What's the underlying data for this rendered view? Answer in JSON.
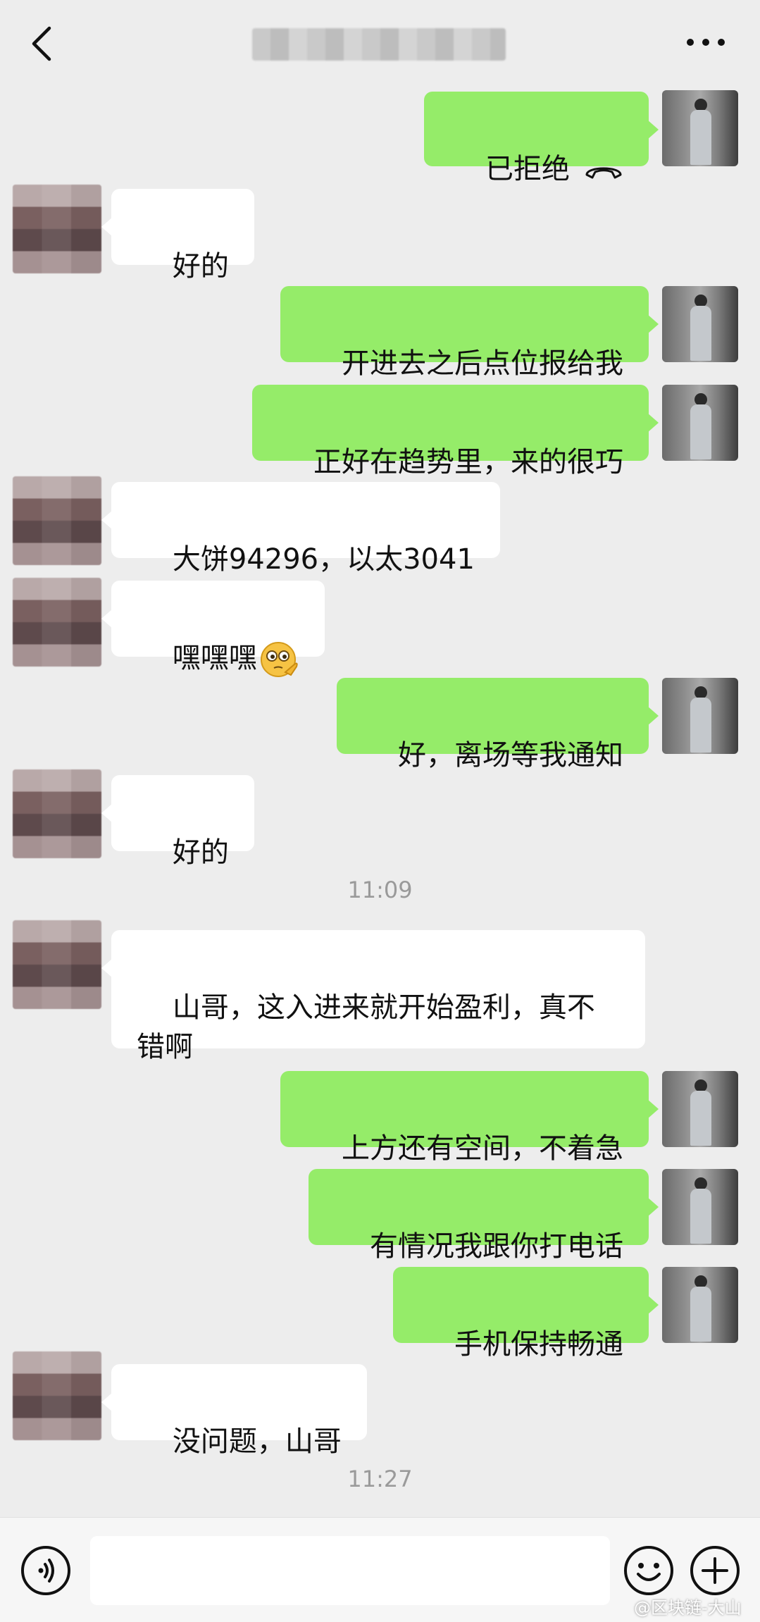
{
  "header": {
    "title": "",
    "back_icon": "chevron-left-icon",
    "more_icon": "more-dots-icon"
  },
  "messages": [
    {
      "from": "me",
      "text": "已拒绝",
      "icon": "phone-hangup-icon"
    },
    {
      "from": "other",
      "text": "好的"
    },
    {
      "from": "me",
      "text": "开进去之后点位报给我"
    },
    {
      "from": "me",
      "text": "正好在趋势里，来的很巧"
    },
    {
      "from": "other",
      "text": "大饼94296，以太3041"
    },
    {
      "from": "other",
      "text": "嘿嘿嘿",
      "icon": "thinking-emoji-icon"
    },
    {
      "from": "me",
      "text": "好，离场等我通知"
    },
    {
      "from": "other",
      "text": "好的"
    },
    {
      "from": "other",
      "text": "山哥，这入进来就开始盈利，真不\n错啊"
    },
    {
      "from": "me",
      "text": "上方还有空间，不着急"
    },
    {
      "from": "me",
      "text": "有情况我跟你打电话"
    },
    {
      "from": "me",
      "text": "手机保持畅通"
    },
    {
      "from": "other",
      "text": "没问题，山哥"
    }
  ],
  "timestamps": [
    "11:09",
    "11:27"
  ],
  "bottom_bar": {
    "input_value": "",
    "input_placeholder": "",
    "voice_icon": "voice-icon",
    "emoji_icon": "emoji-icon",
    "plus_icon": "plus-icon"
  },
  "watermark": "@区块链-大山",
  "colors": {
    "background": "#ededed",
    "my_bubble": "#95ec69",
    "other_bubble": "#ffffff",
    "timestamp": "#9a9a9a"
  }
}
